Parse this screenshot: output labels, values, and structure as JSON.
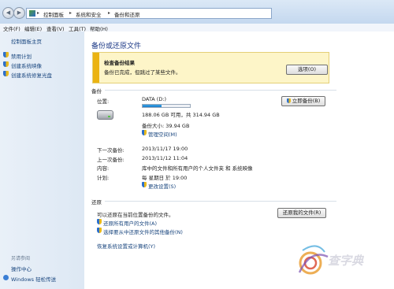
{
  "breadcrumb": [
    "控制面板",
    "系统和安全",
    "备份和还原"
  ],
  "menubar": [
    "文件(F)",
    "编辑(E)",
    "查看(V)",
    "工具(T)",
    "帮助(H)"
  ],
  "sidebar": {
    "home": "控制面板主页",
    "items": [
      "禁用计划",
      "创建系统映像",
      "创建系统修复光盘"
    ],
    "see_also_heading": "另请参阅",
    "see_also": [
      "操作中心",
      "Windows 轻松传送"
    ]
  },
  "main": {
    "title": "备份或还原文件",
    "alert": {
      "title": "检查备份结果",
      "text": "备份已完成，但跳过了某些文件。",
      "button": "选项(O)"
    },
    "backup": {
      "heading": "备份",
      "location_label": "位置:",
      "drive_name": "DATA (D:)",
      "drive_usage_fraction": 0.4,
      "free_space": "188.06 GB 可用，共 314.94 GB",
      "backup_size": "备份大小: 39.94 GB",
      "manage_space": "管理空间(M)",
      "backup_now_button": "立即备份(B)",
      "next_label": "下一次备份:",
      "next_value": "2013/11/17 19:00",
      "last_label": "上一次备份:",
      "last_value": "2013/11/12 11:04",
      "contents_label": "内容:",
      "contents_value": "库中的文件和所有用户的个人文件夹 和 系统映像",
      "schedule_label": "计划:",
      "schedule_value": "每 星期日 於 19:00",
      "change_settings": "更改设置(S)"
    },
    "restore": {
      "heading": "还原",
      "text": "可以还原在当前位置备份的文件。",
      "restore_button": "还原我的文件(R)",
      "all_users_link": "还原所有用户的文件(A)",
      "other_backup_link": "选择要从中还原文件的其他备份(N)",
      "recover_link": "恢复系统设置或计算机(Y)"
    }
  },
  "watermark": "查字典"
}
